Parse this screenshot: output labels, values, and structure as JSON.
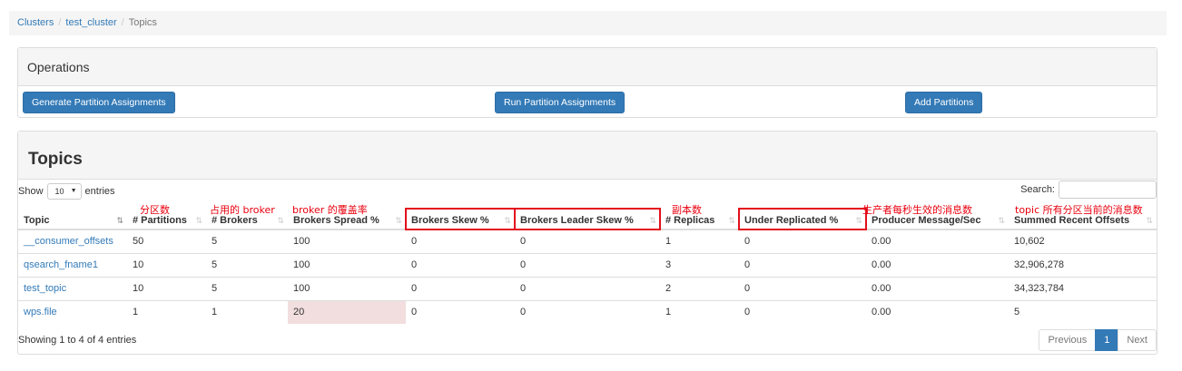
{
  "breadcrumb": {
    "items": [
      "Clusters",
      "test_cluster"
    ],
    "separator": "/",
    "active": "Topics"
  },
  "operations": {
    "title": "Operations",
    "buttons": [
      "Generate Partition Assignments",
      "Run Partition Assignments",
      "Add Partitions"
    ]
  },
  "topics": {
    "title": "Topics",
    "length": {
      "show": "Show",
      "value": "10",
      "entries": "entries"
    },
    "search_label": "Search:",
    "search_value": "",
    "annotations": [
      "分区数",
      "占用的 broker",
      "broker 的覆盖率",
      "副本数",
      "生产者每秒生效的消息数",
      "topic 所有分区当前的消息数"
    ],
    "columns": [
      "Topic",
      "# Partitions",
      "# Brokers",
      "Brokers Spread %",
      "Brokers Skew %",
      "Brokers Leader Skew %",
      "# Replicas",
      "Under Replicated %",
      "Producer Message/Sec",
      "Summed Recent Offsets"
    ],
    "rows": [
      [
        "__consumer_offsets",
        "50",
        "5",
        "100",
        "0",
        "0",
        "1",
        "0",
        "0.00",
        "10,602"
      ],
      [
        "qsearch_fname1",
        "10",
        "5",
        "100",
        "0",
        "0",
        "3",
        "0",
        "0.00",
        "32,906,278"
      ],
      [
        "test_topic",
        "10",
        "5",
        "100",
        "0",
        "0",
        "2",
        "0",
        "0.00",
        "34,323,784"
      ],
      [
        "wps.file",
        "1",
        "1",
        "20",
        "0",
        "0",
        "1",
        "0",
        "0.00",
        "5"
      ]
    ],
    "info": "Showing 1 to 4 of 4 entries",
    "pagination": {
      "previous": "Previous",
      "current": "1",
      "next": "Next"
    }
  },
  "colors": {
    "primary": "#337ab7",
    "annotation_red": "#e30f1b",
    "warning_cell": "#f2dede"
  }
}
